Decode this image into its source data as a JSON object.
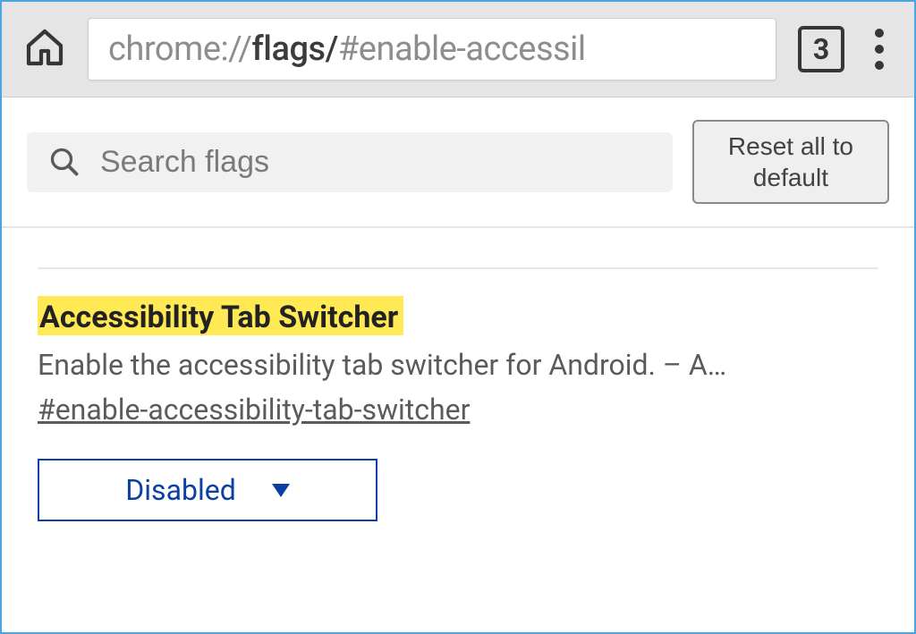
{
  "toolbar": {
    "url_prefix": "chrome://",
    "url_bold": "flags/",
    "url_suffix": "#enable-accessil",
    "tab_count": "3"
  },
  "search": {
    "placeholder": "Search flags",
    "reset_label": "Reset all to\ndefault"
  },
  "flag": {
    "title": "Accessibility Tab Switcher",
    "description": "Enable the accessibility tab switcher for Android. – A…",
    "hash": "#enable-accessibility-tab-switcher",
    "selected_option": "Disabled"
  },
  "icons": {
    "home": "home-icon",
    "search": "search-icon",
    "kebab": "menu-icon",
    "tabcount": "tab-count-icon",
    "dropdown": "chevron-down-icon"
  }
}
